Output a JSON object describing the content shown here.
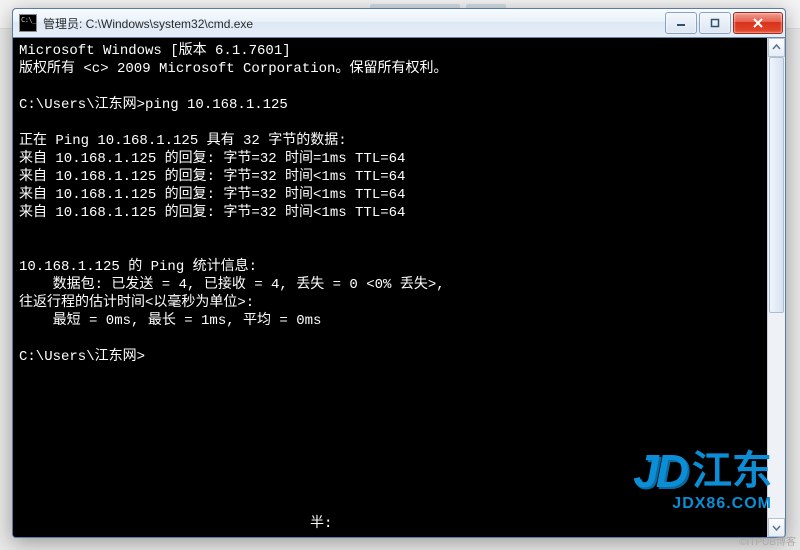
{
  "window": {
    "title": "管理员: C:\\Windows\\system32\\cmd.exe",
    "controls": {
      "minimize": "minimize",
      "maximize": "maximize",
      "close": "close"
    }
  },
  "terminal": {
    "lines": [
      "Microsoft Windows [版本 6.1.7601]",
      "版权所有 <c> 2009 Microsoft Corporation。保留所有权利。",
      "",
      "C:\\Users\\江东网>ping 10.168.1.125",
      "",
      "正在 Ping 10.168.1.125 具有 32 字节的数据:",
      "来自 10.168.1.125 的回复: 字节=32 时间=1ms TTL=64",
      "来自 10.168.1.125 的回复: 字节=32 时间<1ms TTL=64",
      "来自 10.168.1.125 的回复: 字节=32 时间<1ms TTL=64",
      "来自 10.168.1.125 的回复: 字节=32 时间<1ms TTL=64",
      "",
      "",
      "10.168.1.125 的 Ping 统计信息:",
      "    数据包: 已发送 = 4, 已接收 = 4, 丢失 = 0 <0% 丢失>,",
      "往返行程的估计时间<以毫秒为单位>:",
      "    最短 = 0ms, 最长 = 1ms, 平均 = 0ms",
      "",
      "C:\\Users\\江东网>"
    ],
    "bottom_fragment": "半:"
  },
  "watermark": {
    "logo_left": "JD",
    "logo_right": "江东",
    "sub": "JDX86.COM"
  },
  "credit": "©ITPUB博客"
}
